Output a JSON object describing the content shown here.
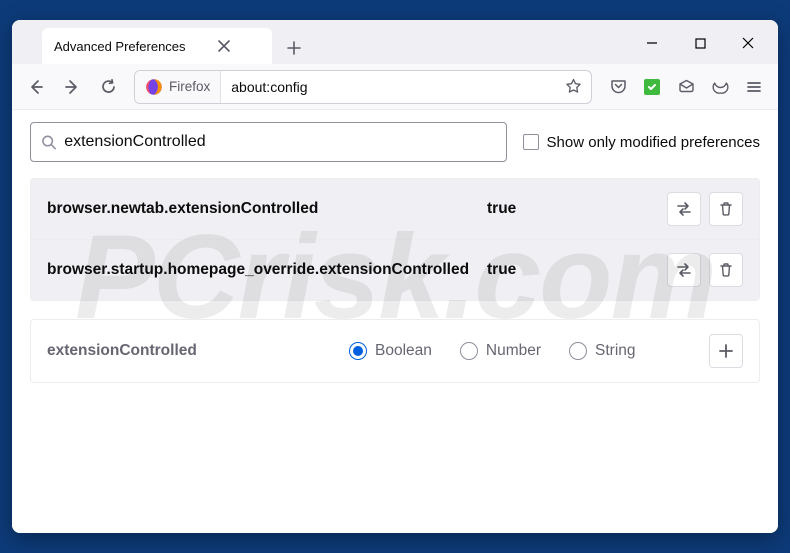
{
  "window": {
    "tab_title": "Advanced Preferences"
  },
  "toolbar": {
    "identity_label": "Firefox",
    "url": "about:config"
  },
  "config": {
    "search_value": "extensionControlled",
    "modified_only_label": "Show only modified preferences",
    "prefs": [
      {
        "name": "browser.newtab.extensionControlled",
        "value": "true"
      },
      {
        "name": "browser.startup.homepage_override.extensionControlled",
        "value": "true"
      }
    ],
    "new_pref_name": "extensionControlled",
    "types": {
      "boolean": "Boolean",
      "number": "Number",
      "string": "String"
    }
  },
  "watermark": "PCrisk.com"
}
